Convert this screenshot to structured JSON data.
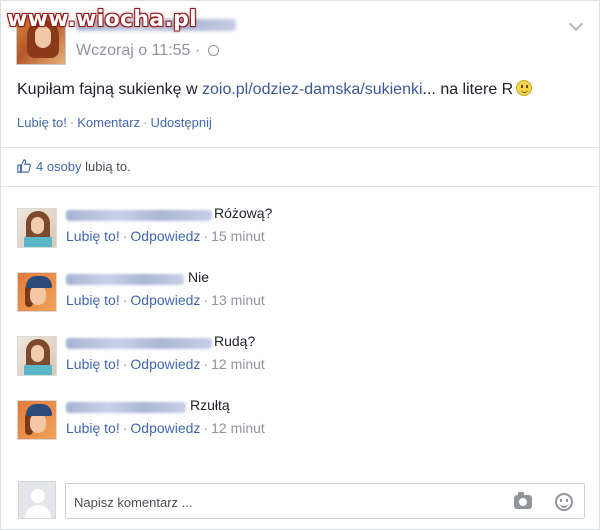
{
  "watermark": "www.wiocha.pl",
  "post": {
    "author": "",
    "time": "Wczoraj o 11:55",
    "text_before": "Kupiłam fajną sukienkę w ",
    "link": "zoio.pl/odziez-damska/sukienki",
    "text_after": "... na litere R",
    "actions": {
      "like": "Lubię to!",
      "comment": "Komentarz",
      "share": "Udostępnij",
      "sep": "·"
    }
  },
  "likes": {
    "count": "4 osoby",
    "text": "lubią to."
  },
  "icons": {
    "globe": "globe-icon",
    "chevron": "chevron-down-icon",
    "thumb": "thumbs-up-icon",
    "camera": "camera-icon",
    "emoji": "emoji-icon",
    "smiley": "smiley-emoji-icon"
  },
  "colors": {
    "link": "#4267b2",
    "meta": "#90949c",
    "text": "#1d2129"
  },
  "comments": [
    {
      "text": "Różową?",
      "like": "Lubię to!",
      "reply": "Odpowiedz",
      "time": "15 minut",
      "sep": "·"
    },
    {
      "text": "Nie",
      "like": "Lubię to!",
      "reply": "Odpowiedz",
      "time": "13 minut",
      "sep": "·"
    },
    {
      "text": "Rudą?",
      "like": "Lubię to!",
      "reply": "Odpowiedz",
      "time": "12 minut",
      "sep": "·"
    },
    {
      "text": "Rzułtą",
      "like": "Lubię to!",
      "reply": "Odpowiedz",
      "time": "12 minut",
      "sep": "·"
    }
  ],
  "composer": {
    "placeholder": "Napisz komentarz ..."
  }
}
